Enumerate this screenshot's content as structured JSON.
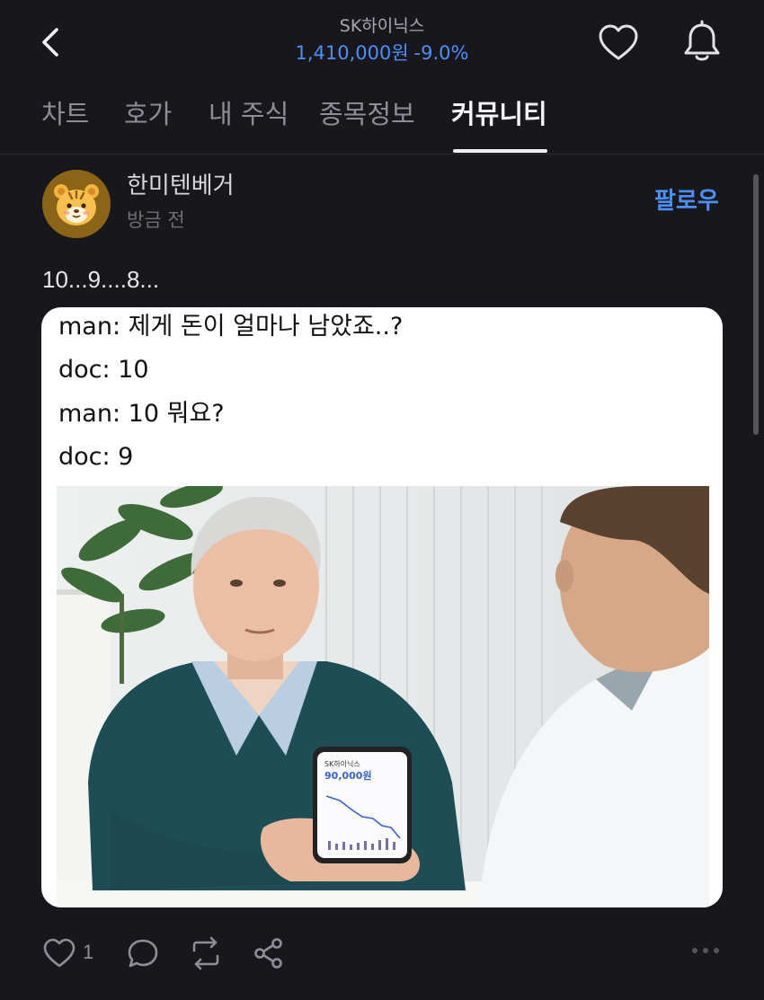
{
  "header": {
    "stock_name": "SK하이닉스",
    "price": "1,410,000원",
    "change": "-9.0%"
  },
  "tabs": [
    {
      "label": "차트"
    },
    {
      "label": "호가"
    },
    {
      "label": "내 주식"
    },
    {
      "label": "종목정보"
    },
    {
      "label": "커뮤니티"
    }
  ],
  "active_tab": "커뮤니티",
  "post": {
    "author": "한미텐베거",
    "time": "방금 전",
    "follow_label": "팔로우",
    "text": "10...9....8...",
    "meme_lines": [
      "man: 제게 돈이 얼마나 남았죠..?",
      "doc: 10",
      "man: 10 뭐요?",
      "doc: 9"
    ],
    "like_count": "1"
  },
  "photo": {
    "phone_title": "SK하이닉스",
    "phone_price": "90,000원"
  },
  "colors": {
    "background": "#17171c",
    "accent_blue": "#4d8ff7",
    "muted": "#8e8e97"
  },
  "icons": [
    "back-arrow-icon",
    "heart-icon",
    "bell-icon",
    "comment-icon",
    "repost-icon",
    "share-icon",
    "more-icon"
  ]
}
